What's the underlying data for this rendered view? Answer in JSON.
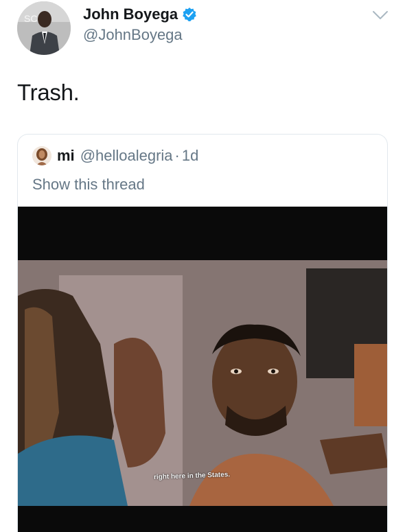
{
  "author": {
    "display_name": "John Boyega",
    "handle": "@JohnBoyega",
    "verified": true,
    "avatar_icon": "profile-photo-man-in-suit"
  },
  "tweet": {
    "text": "Trash."
  },
  "quoted_tweet": {
    "display_name": "mi",
    "handle": "@helloalegria",
    "separator": "·",
    "time": "1d",
    "show_thread_label": "Show this thread",
    "media": {
      "subtitle": "right here in the States."
    }
  },
  "colors": {
    "verified_badge": "#1da1f2",
    "secondary_text": "#657786",
    "primary_text": "#14171a",
    "card_border": "#e1e8ed"
  }
}
